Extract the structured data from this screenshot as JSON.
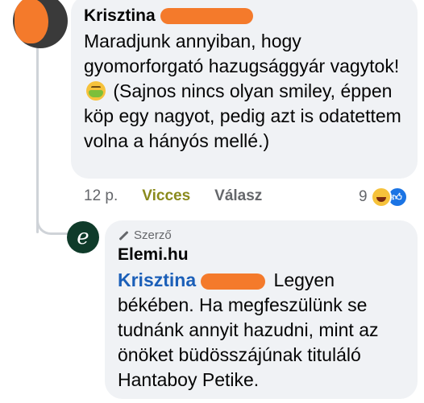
{
  "comment": {
    "author": "Krisztina",
    "text_before_emoji": "Maradjunk annyiban, hogy gyomorforgató hazugsággyár vagytok!",
    "emoji_icon": "nauseated-face-icon",
    "text_after_emoji": "(Sajnos nincs olyan smiley, éppen köp egy nagyot, pedig azt is odatettem volna a hányós mellé.)",
    "time": "12 p.",
    "reaction_label": "Vicces",
    "reply_label": "Válasz",
    "reaction_count": "9",
    "reaction_icons": [
      "haha-icon",
      "like-icon"
    ]
  },
  "reply": {
    "badge": "Szerző",
    "author": "Elemi.hu",
    "avatar_letter": "e",
    "mention": "Krisztina",
    "text": "Legyen békében. Ha megfeszülünk se tudnánk annyit hazudni, mint az önöket büdösszájúnak tituláló Hantaboy Petike."
  },
  "colors": {
    "bubble": "#f0f2f5",
    "redaction": "#f47a2b",
    "mention": "#1b5fb8",
    "reaction_label": "#8a8a1c",
    "like": "#1b74e4"
  }
}
